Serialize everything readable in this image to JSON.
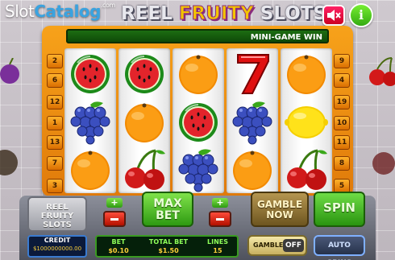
{
  "header": {
    "watermark": {
      "part1": "Slot",
      "part2": "Catalog",
      "suffix": ".com"
    },
    "title": {
      "left": "REEL ",
      "middle": "FRUITY",
      "right": " SLOTS"
    },
    "sound_icon": "sound-muted-icon",
    "info_label": "i"
  },
  "message_bar": "MINI-GAME WIN",
  "paylines_left": [
    "2",
    "6",
    "12",
    "1",
    "13",
    "7",
    "3"
  ],
  "paylines_right": [
    "9",
    "4",
    "19",
    "10",
    "11",
    "8",
    "5"
  ],
  "reels": [
    [
      "watermelon",
      "grapes",
      "orange"
    ],
    [
      "watermelon",
      "orange",
      "cherries"
    ],
    [
      "orange",
      "watermelon",
      "grapes"
    ],
    [
      "seven",
      "grapes",
      "orange"
    ],
    [
      "orange",
      "lemon",
      "cherries"
    ]
  ],
  "controls": {
    "logo_badge": {
      "line1": "REEL",
      "line2": "FRUITY",
      "line3": "SLOTS"
    },
    "max_bet": {
      "line1": "MAX",
      "line2": "BET"
    },
    "gamble_now": {
      "line1": "GAMBLE",
      "line2": "NOW"
    },
    "spin": "SPIN",
    "bet_plus": "+",
    "lines_plus": "+"
  },
  "status": {
    "credit_label": "CREDIT",
    "credit_value": "$1000000000.00",
    "bet_label": "BET",
    "bet_value": "$0.10",
    "total_bet_label": "TOTAL BET",
    "total_bet_value": "$1.50",
    "lines_label": "LINES",
    "lines_value": "15",
    "gamble_label": "GAMBLE",
    "gamble_state": "OFF",
    "auto_spins": "AUTO SPINS"
  },
  "colors": {
    "frame_orange": "#f19418",
    "message_green": "#1d6d12",
    "spin_green": "#3ab51a",
    "credit_blue": "#0b1a3a"
  }
}
